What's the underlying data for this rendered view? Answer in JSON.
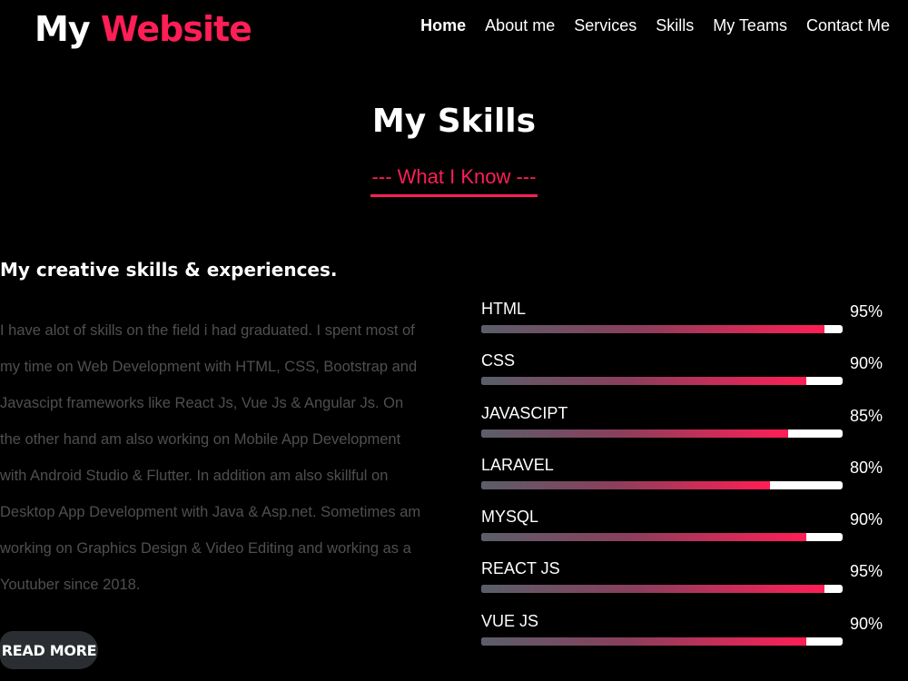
{
  "header": {
    "logo_part1": "My",
    "logo_part2": "Website",
    "nav": [
      {
        "label": "Home",
        "active": true
      },
      {
        "label": "About me"
      },
      {
        "label": "Services"
      },
      {
        "label": "Skills"
      },
      {
        "label": "My Teams"
      },
      {
        "label": "Contact Me"
      }
    ]
  },
  "section": {
    "title": "My Skills",
    "subtitle": "--- What I Know ---"
  },
  "left": {
    "heading": "My creative skills & experiences.",
    "text": "I have alot of skills on the field i had graduated. I spent most of my time on Web Development with HTML, CSS, Bootstrap and Javascipt frameworks like React Js, Vue Js & Angular Js. On the other hand am also working on Mobile App Development with Android Studio & Flutter. In addition am also skillful on Desktop App Development with Java & Asp.net. Sometimes am working on Graphics Design & Video Editing and working as a Youtuber since 2018.",
    "button_label": "READ MORE"
  },
  "skills": [
    {
      "name": "HTML",
      "percent_label": "95%",
      "value": 95
    },
    {
      "name": "CSS",
      "percent_label": "90%",
      "value": 90
    },
    {
      "name": "JAVASCIPT",
      "percent_label": "85%",
      "value": 85
    },
    {
      "name": "LARAVEL",
      "percent_label": "80%",
      "value": 80
    },
    {
      "name": "MYSQL",
      "percent_label": "90%",
      "value": 90
    },
    {
      "name": "REACT JS",
      "percent_label": "95%",
      "value": 95
    },
    {
      "name": "VUE JS",
      "percent_label": "90%",
      "value": 90
    }
  ],
  "colors": {
    "background": "#000000",
    "accent": "#ff1e56",
    "body_text": "#4f4f4f",
    "button_bg": "#2a2e33"
  }
}
